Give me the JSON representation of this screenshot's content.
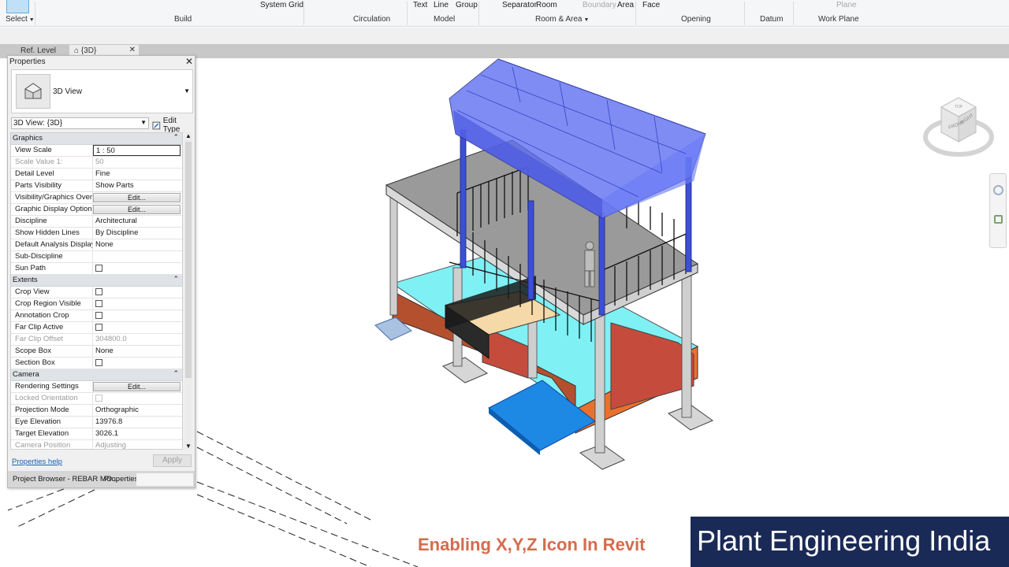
{
  "ribbon": {
    "buttons": {
      "select": "Select",
      "system": "System",
      "grid": "Grid",
      "text": "Text",
      "line": "Line",
      "group": "Group",
      "separator": "Separator",
      "room": "Room",
      "boundary": "Boundary",
      "area": "Area",
      "face": "Face",
      "plane": "Plane"
    },
    "panels": {
      "build": "Build",
      "circulation": "Circulation",
      "model": "Model",
      "room_area": "Room & Area",
      "opening": "Opening",
      "datum": "Datum",
      "work_plane": "Work Plane"
    }
  },
  "tabs": {
    "ref_level": "Ref. Level",
    "three_d": "{3D}"
  },
  "properties": {
    "title": "Properties",
    "type_name": "3D View",
    "instance_filter": "3D View: {3D}",
    "edit_type": "Edit Type",
    "help": "Properties help",
    "apply": "Apply",
    "groups": {
      "graphics": "Graphics",
      "extents": "Extents",
      "camera": "Camera"
    },
    "rows": {
      "view_scale": {
        "label": "View Scale",
        "value": "1 : 50"
      },
      "scale_value": {
        "label": "Scale Value    1:",
        "value": "50"
      },
      "detail_level": {
        "label": "Detail Level",
        "value": "Fine"
      },
      "parts_visibility": {
        "label": "Parts Visibility",
        "value": "Show Parts"
      },
      "vg_overrides": {
        "label": "Visibility/Graphics Overrides",
        "value": "Edit..."
      },
      "graphic_display": {
        "label": "Graphic Display Options",
        "value": "Edit..."
      },
      "discipline": {
        "label": "Discipline",
        "value": "Architectural"
      },
      "hidden_lines": {
        "label": "Show Hidden Lines",
        "value": "By Discipline"
      },
      "default_analysis": {
        "label": "Default Analysis Display St...",
        "value": "None"
      },
      "sub_discipline": {
        "label": "Sub-Discipline",
        "value": ""
      },
      "sun_path": {
        "label": "Sun Path",
        "value": ""
      },
      "crop_view": {
        "label": "Crop View",
        "value": ""
      },
      "crop_region_visible": {
        "label": "Crop Region Visible",
        "value": ""
      },
      "annotation_crop": {
        "label": "Annotation Crop",
        "value": ""
      },
      "far_clip_active": {
        "label": "Far Clip Active",
        "value": ""
      },
      "far_clip_offset": {
        "label": "Far Clip Offset",
        "value": "304800.0"
      },
      "scope_box": {
        "label": "Scope Box",
        "value": "None"
      },
      "section_box": {
        "label": "Section Box",
        "value": ""
      },
      "rendering_settings": {
        "label": "Rendering Settings",
        "value": "Edit..."
      },
      "locked_orientation": {
        "label": "Locked Orientation",
        "value": ""
      },
      "projection_mode": {
        "label": "Projection Mode",
        "value": "Orthographic"
      },
      "eye_elevation": {
        "label": "Eye Elevation",
        "value": "13976.8"
      },
      "target_elevation": {
        "label": "Target Elevation",
        "value": "3026.1"
      },
      "camera_position": {
        "label": "Camera Position",
        "value": "Adjusting"
      }
    },
    "bottom_tabs": {
      "project_browser": "Project Browser - REBAR MO...",
      "properties": "Properties"
    }
  },
  "viewcube": {
    "front": "FRONT",
    "right": "RIGHT",
    "top": "TOP"
  },
  "caption": "Enabling X,Y,Z Icon In Revit",
  "brand": "Plant Engineering India"
}
